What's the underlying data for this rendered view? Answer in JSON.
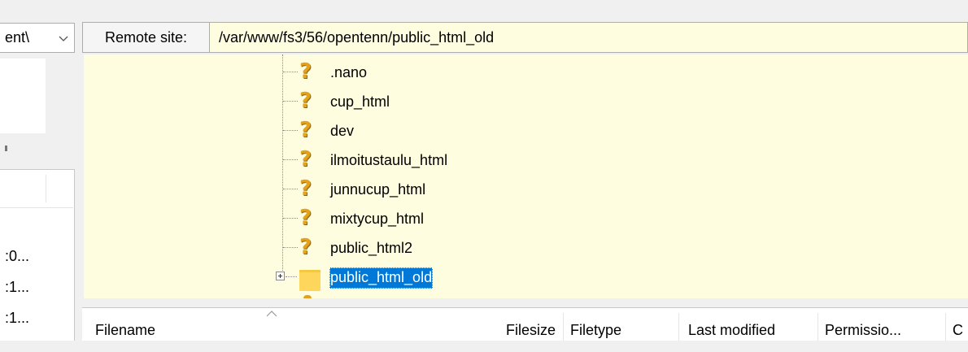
{
  "local": {
    "path_value": "ent\\",
    "list_rows": [
      ":0...",
      ":1...",
      ":1..."
    ]
  },
  "remote": {
    "site_label": "Remote site:",
    "path_value": "/var/www/fs3/56/opentenn/public_html_old",
    "tree_items": [
      {
        "label": ".nano",
        "icon": "unknown-question-icon"
      },
      {
        "label": "cup_html",
        "icon": "unknown-question-icon"
      },
      {
        "label": "dev",
        "icon": "unknown-question-icon"
      },
      {
        "label": "ilmoitustaulu_html",
        "icon": "unknown-question-icon"
      },
      {
        "label": "junnucup_html",
        "icon": "unknown-question-icon"
      },
      {
        "label": "mixtycup_html",
        "icon": "unknown-question-icon"
      },
      {
        "label": "public_html2",
        "icon": "unknown-question-icon"
      },
      {
        "label": "public_html_old",
        "icon": "folder-icon",
        "selected": true
      }
    ],
    "columns": [
      "Filename",
      "Filesize",
      "Filetype",
      "Last modified",
      "Permissio...",
      "C"
    ]
  },
  "colors": {
    "remote_background": "#fffde0",
    "selection": "#0078d7",
    "question_icon": "#e3a21a",
    "folder": "#ffd65c"
  }
}
